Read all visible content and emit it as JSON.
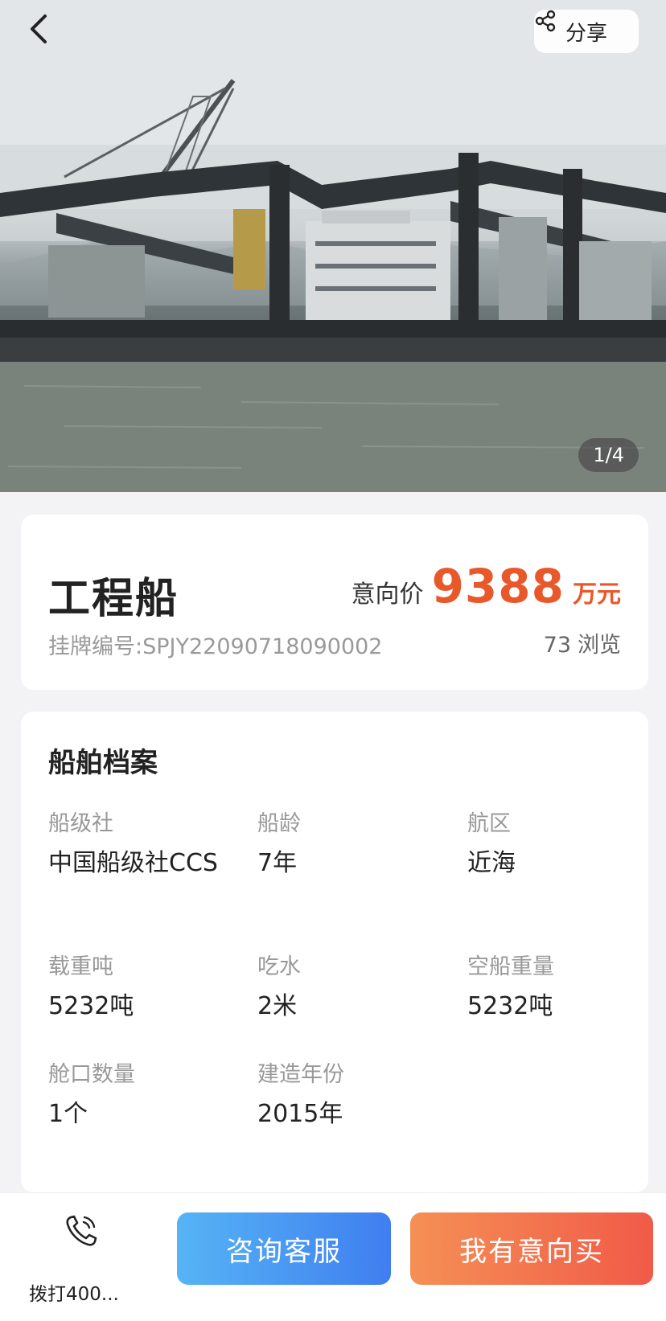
{
  "header": {
    "share_label": "分享",
    "image_counter": "1/4"
  },
  "listing": {
    "name": "工程船",
    "price_label": "意向价",
    "price_value": "9388",
    "price_unit": "万元",
    "listing_no_label": "挂牌编号:",
    "listing_no": "SPJY22090718090002",
    "views_count": "73",
    "views_label": "浏览"
  },
  "specs": {
    "title": "船舶档案",
    "items": [
      {
        "key": "船级社",
        "value": "中国船级社CCS"
      },
      {
        "key": "船龄",
        "value": "7年"
      },
      {
        "key": "航区",
        "value": "近海"
      },
      {
        "key": "载重吨",
        "value": "5232吨"
      },
      {
        "key": "吃水",
        "value": "2米"
      },
      {
        "key": "空船重量",
        "value": "5232吨"
      },
      {
        "key": "舱口数量",
        "value": "1个"
      },
      {
        "key": "建造年份",
        "value": "2015年"
      }
    ]
  },
  "bottom": {
    "call_label": "拨打400...",
    "consult_label": "咨询客服",
    "buy_label": "我有意向买"
  },
  "colors": {
    "price": "#e8582a",
    "consult_btn": "#3f7ef0",
    "buy_btn": "#f15a48"
  },
  "icons": {
    "back": "chevron-left-icon",
    "share": "share-icon",
    "call": "phone-icon"
  }
}
